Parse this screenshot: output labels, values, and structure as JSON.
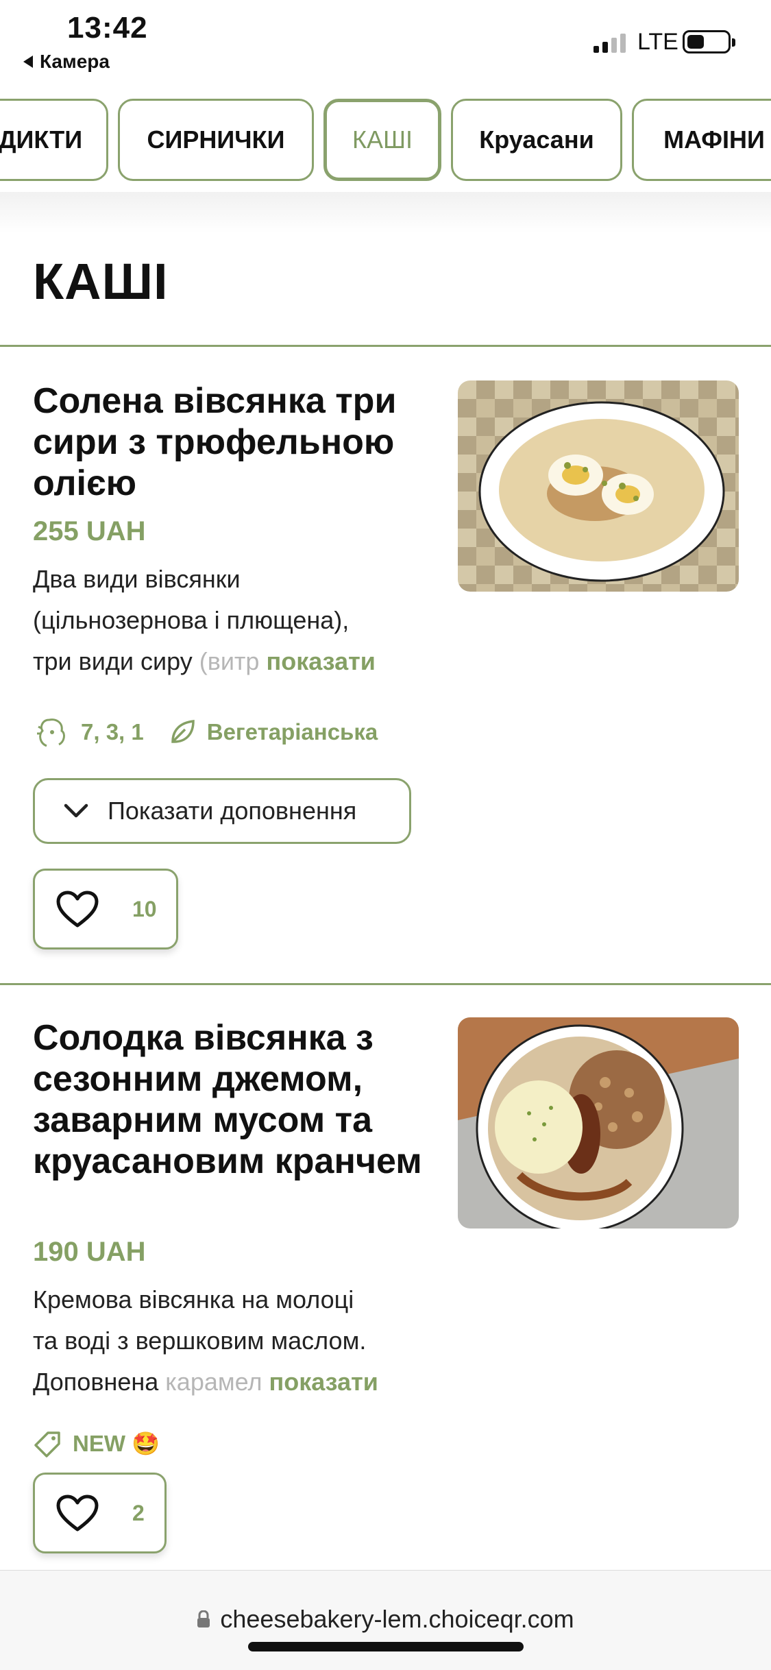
{
  "status_bar": {
    "time": "13:42",
    "back_app": "Камера",
    "network": "LTE"
  },
  "categories": [
    {
      "label": "ДИКТИ",
      "active": false
    },
    {
      "label": "СИРНИЧКИ",
      "active": false
    },
    {
      "label": "КАШІ",
      "active": true
    },
    {
      "label": "Круасани",
      "active": false
    },
    {
      "label": "МАФІНИ",
      "active": false
    }
  ],
  "section": {
    "title": "КАШІ"
  },
  "products": [
    {
      "title": "Солена вівсянка три сири з трюфельною олією",
      "price": "255 UAH",
      "desc_line1": "Два види вівсянки",
      "desc_line2": "(цільнозернова і плющена),",
      "desc_line3": "три види сиру ",
      "desc_fade": "(витр",
      "show_more": "показати",
      "allergens": "7, 3, 1",
      "diet": "Вегетаріанська",
      "addons_label": "Показати доповнення",
      "likes": "10"
    },
    {
      "title": "Солодка вівсянка з сезонним джемом, заварним мусом та круасановим кранчем",
      "price": "190 UAH",
      "desc_line1": "Кремова вівсянка на молоці",
      "desc_line2": "та воді з вершковим маслом.",
      "desc_line3": "Доповнена ",
      "desc_fade": "карамел",
      "show_more": "показати",
      "tag": "NEW 🤩",
      "likes": "2"
    }
  ],
  "browser": {
    "url": "cheesebakery-lem.choiceqr.com"
  },
  "colors": {
    "accent": "#85a064",
    "border": "#8aa26d"
  }
}
